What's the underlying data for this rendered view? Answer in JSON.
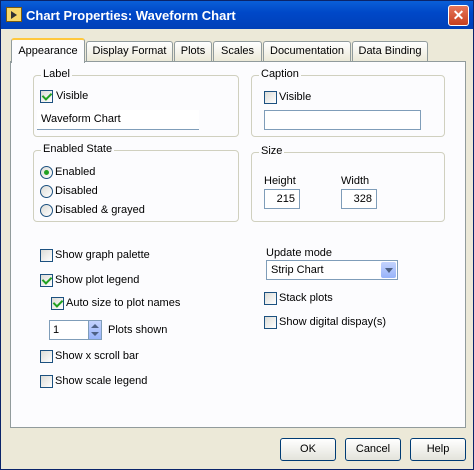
{
  "window": {
    "title": "Chart Properties: Waveform Chart",
    "close_glyph": "✕"
  },
  "tabs": [
    {
      "label": "Appearance",
      "active": true
    },
    {
      "label": "Display Format"
    },
    {
      "label": "Plots"
    },
    {
      "label": "Scales"
    },
    {
      "label": "Documentation"
    },
    {
      "label": "Data Binding"
    }
  ],
  "label_group": {
    "title": "Label",
    "visible_label": "Visible",
    "visible_checked": true,
    "value": "Waveform Chart"
  },
  "caption_group": {
    "title": "Caption",
    "visible_label": "Visible",
    "visible_checked": false,
    "value": ""
  },
  "enabled_state": {
    "title": "Enabled State",
    "options": [
      {
        "label": "Enabled",
        "selected": true
      },
      {
        "label": "Disabled",
        "selected": false
      },
      {
        "label": "Disabled & grayed",
        "selected": false
      }
    ]
  },
  "size_group": {
    "title": "Size",
    "height_label": "Height",
    "height_value": "215",
    "width_label": "Width",
    "width_value": "328"
  },
  "options": {
    "show_graph_palette": {
      "label": "Show graph palette",
      "checked": false
    },
    "show_plot_legend": {
      "label": "Show plot legend",
      "checked": true
    },
    "auto_size": {
      "label": "Auto size to plot names",
      "checked": true
    },
    "plots_shown_value": "1",
    "plots_shown_label": "Plots shown",
    "show_x_scroll_bar": {
      "label": "Show x scroll bar",
      "checked": false
    },
    "show_scale_legend": {
      "label": "Show scale legend",
      "checked": false
    }
  },
  "update_mode": {
    "label": "Update mode",
    "value": "Strip Chart"
  },
  "stack_plots": {
    "label": "Stack plots",
    "checked": false
  },
  "show_digital_display": {
    "label": "Show digital dispay(s)",
    "checked": false
  },
  "buttons": {
    "ok": "OK",
    "cancel": "Cancel",
    "help": "Help"
  }
}
